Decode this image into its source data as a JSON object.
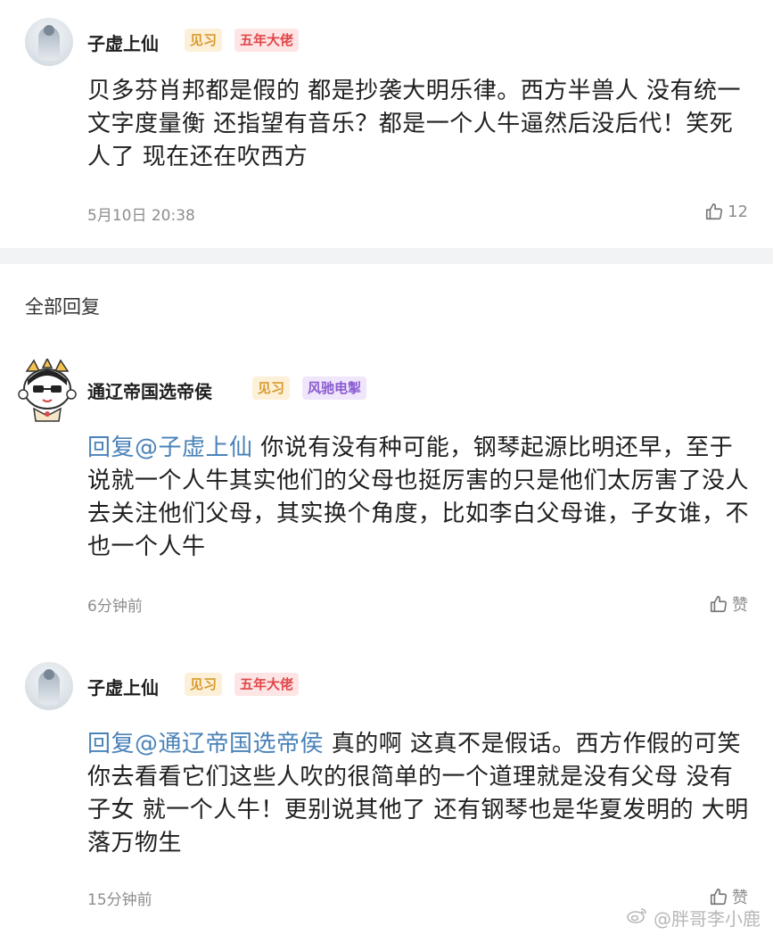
{
  "main_comment": {
    "username": "子虚上仙",
    "badges": [
      "见习",
      "五年大佬"
    ],
    "text": "贝多芬肖邦都是假的 都是抄袭大明乐律。西方半兽人 没有统一文字度量衡 还指望有音乐？都是一个人牛逼然后没后代！笑死人了 现在还在吹西方",
    "time": "5月10日 20:38",
    "likes": "12"
  },
  "section": {
    "title": "全部回复"
  },
  "replies": [
    {
      "username": "通辽帝国选帝侯",
      "badges": [
        "见习",
        "风驰电掣"
      ],
      "reply_prefix": "回复@子虚上仙",
      "text": " 你说有没有种可能，钢琴起源比明还早，至于说就一个人牛其实他们的父母也挺厉害的只是他们太厉害了没人去关注他们父母，其实换个角度，比如李白父母谁，子女谁，不也一个人牛",
      "time": "6分钟前",
      "like_label": "赞"
    },
    {
      "username": "子虚上仙",
      "badges": [
        "见习",
        "五年大佬"
      ],
      "reply_prefix": "回复@通辽帝国选帝侯",
      "text": " 真的啊 这真不是假话。西方作假的可笑 你去看看它们这些人吹的很简单的一个道理就是没有父母 没有子女 就一个人牛！更别说其他了 还有钢琴也是华夏发明的 大明落万物生",
      "time": "15分钟前",
      "like_label": "赞"
    }
  ],
  "watermark": {
    "text": "@胖哥李小鹿",
    "icon": "weibo-icon"
  }
}
